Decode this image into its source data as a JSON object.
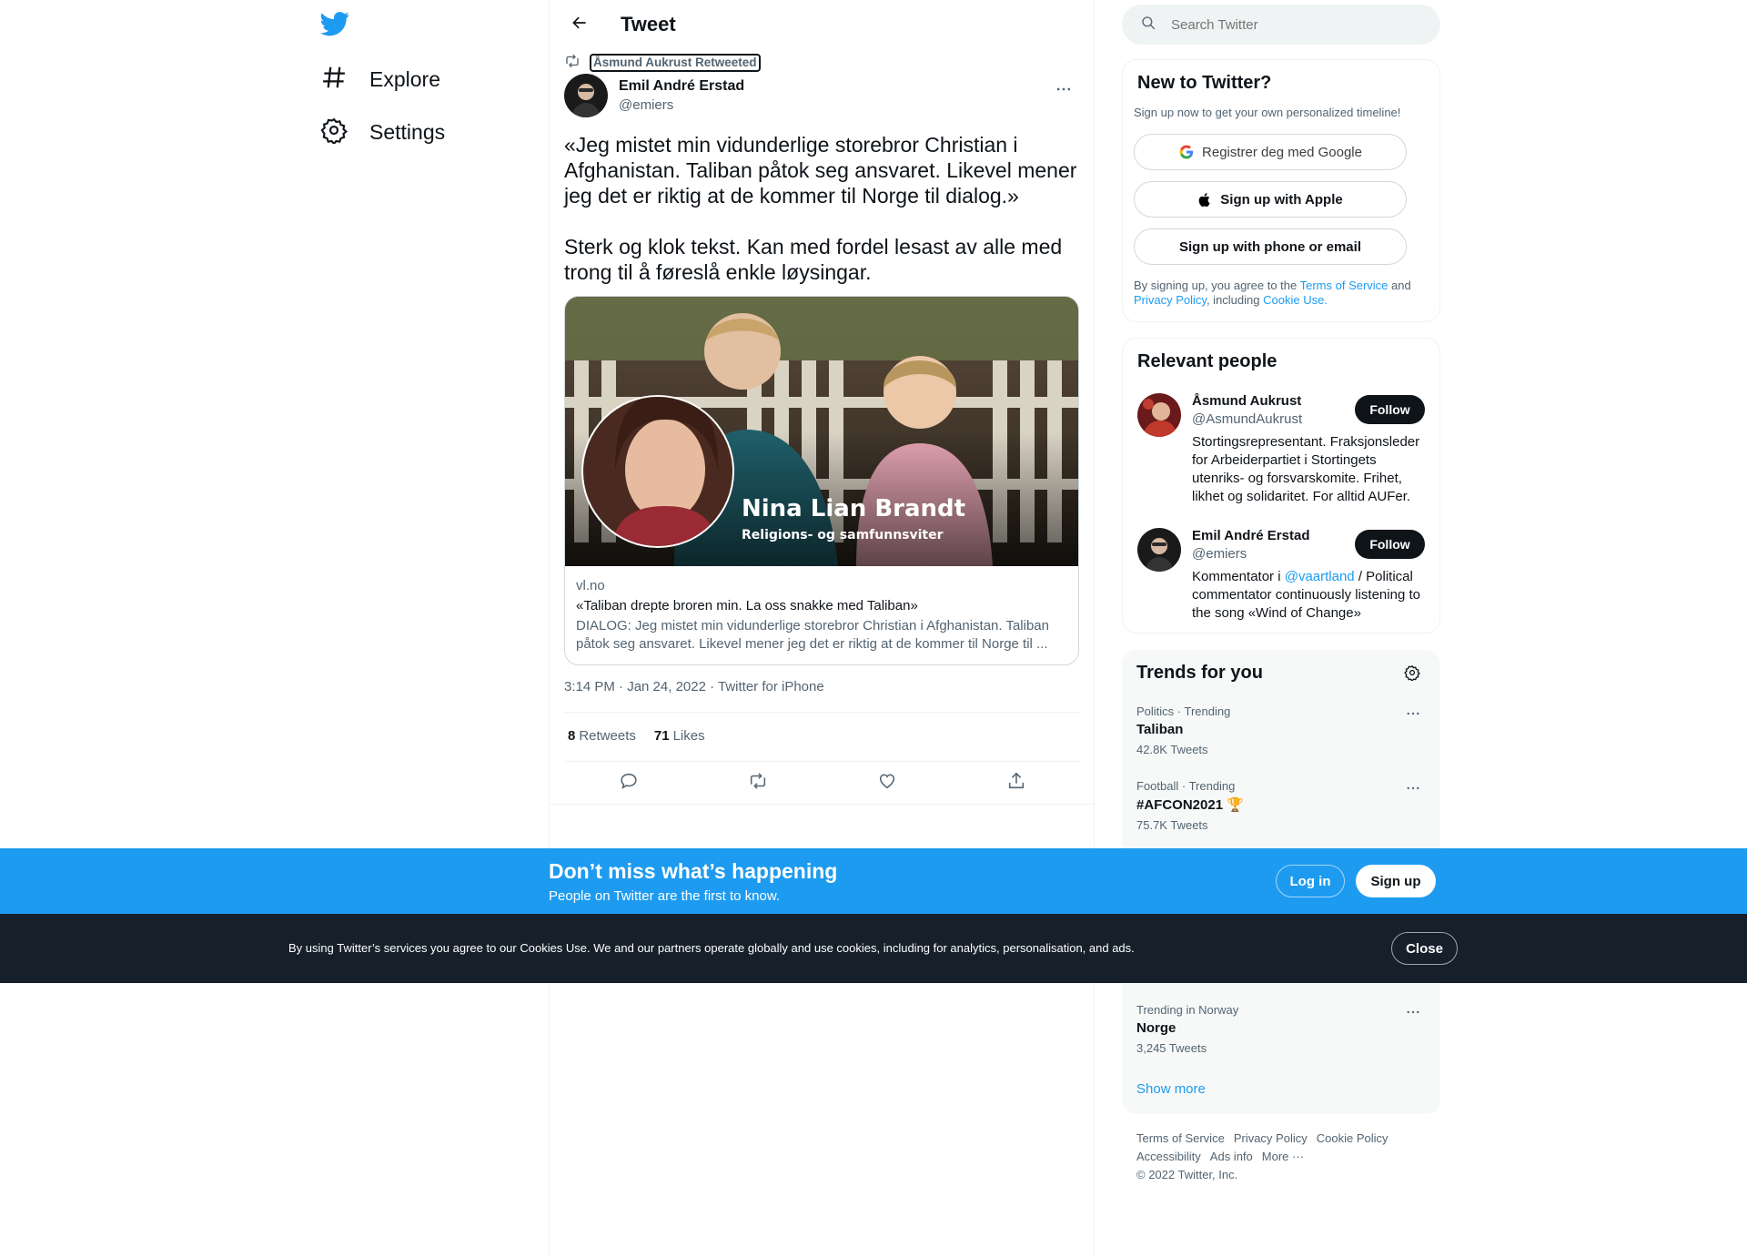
{
  "nav": {
    "logo": "twitter-bird-icon",
    "items": [
      {
        "label": "Explore",
        "icon": "hashtag-icon"
      },
      {
        "label": "Settings",
        "icon": "gear-icon"
      }
    ]
  },
  "header": {
    "title": "Tweet"
  },
  "tweet": {
    "retweeted_by": "Åsmund Aukrust Retweeted",
    "author_name": "Emil André Erstad",
    "author_handle": "@emiers",
    "text": "«Jeg mistet min vidunderlige storebror Christian i Afghanistan. Taliban påtok seg ansvaret. Likevel mener jeg det er riktig at de kommer til Norge til dialog.»\n\nSterk og klok tekst. Kan med fordel lesast av alle med trong til å føreslå enkle løysingar.",
    "card": {
      "image_name": "Nina Lian Brandt",
      "image_sub": "Religions- og samfunnsviter",
      "domain": "vl.no",
      "title": "«Taliban drepte broren min. La oss snakke med Taliban»",
      "description": "DIALOG: Jeg mistet min vidunderlige storebror Christian i Afghanistan. Taliban påtok seg ansvaret. Likevel mener jeg det er riktig at de kommer til Norge til ..."
    },
    "meta": "3:14 PM · Jan 24, 2022 · Twitter for iPhone",
    "retweets_count": "8",
    "retweets_label": "Retweets",
    "likes_count": "71",
    "likes_label": "Likes"
  },
  "search": {
    "placeholder": "Search Twitter"
  },
  "signup": {
    "title": "New to Twitter?",
    "subtitle": "Sign up now to get your own personalized timeline!",
    "google": "Registrer deg med Google",
    "apple": "Sign up with Apple",
    "phone": "Sign up with phone or email",
    "legal_1": "By signing up, you agree to the ",
    "legal_terms": "Terms of Service",
    "legal_2": " and ",
    "legal_privacy": "Privacy Policy",
    "legal_3": ", including ",
    "legal_cookie": "Cookie Use."
  },
  "people": {
    "title": "Relevant people",
    "list": [
      {
        "name": "Åsmund Aukrust",
        "handle": "@AsmundAukrust",
        "bio": "Stortingsrepresentant. Fraksjonsleder for Arbeiderpartiet i Stortingets utenriks- og forsvarskomite. Frihet, likhet og solidaritet. For alltid AUFer.",
        "follow": "Follow"
      },
      {
        "name": "Emil André Erstad",
        "handle": "@emiers",
        "bio_1": "Kommentator i ",
        "bio_link": "@vaartland",
        "bio_2": " / Political commentator continuously listening to the song «Wind of Change»",
        "follow": "Follow"
      }
    ]
  },
  "trends": {
    "title": "Trends for you",
    "items": [
      {
        "context": "Politics · Trending",
        "name": "Taliban",
        "count": "42.8K Tweets"
      },
      {
        "context": "Football · Trending",
        "name": "#AFCON2021 🏆",
        "count": "75.7K Tweets"
      },
      {
        "context": "Trending in Norway",
        "name": "Norge",
        "count": "3,245 Tweets"
      }
    ],
    "show_more": "Show more"
  },
  "footer": {
    "links": [
      "Terms of Service",
      "Privacy Policy",
      "Cookie Policy",
      "Accessibility",
      "Ads info",
      "More ···"
    ],
    "copyright": "© 2022 Twitter, Inc."
  },
  "banner": {
    "title": "Don’t miss what’s happening",
    "subtitle": "People on Twitter are the first to know.",
    "login": "Log in",
    "signup": "Sign up"
  },
  "cookie": {
    "text": "By using Twitter’s services you agree to our Cookies Use. We and our partners operate globally and use cookies, including for analytics, personalisation, and ads.",
    "close": "Close"
  },
  "colors": {
    "brand_blue": "#1d9bf0",
    "text_dark": "#0f1419",
    "text_gray": "#536471",
    "cookie_bg": "#15202b"
  }
}
